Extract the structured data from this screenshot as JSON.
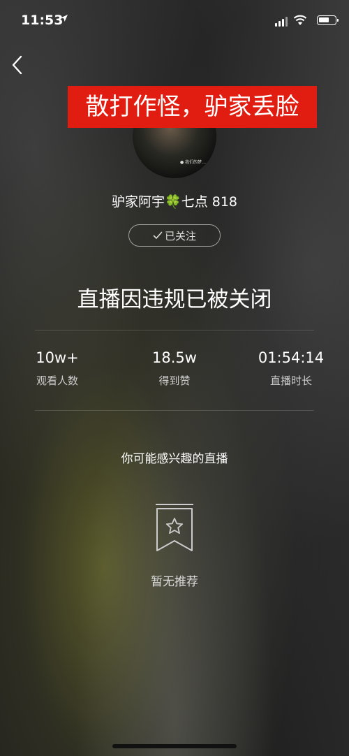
{
  "status": {
    "time": "11:53"
  },
  "banner": {
    "text": "散打作怪，驴家丢脸"
  },
  "avatar": {
    "caption": "● 我们的梦…"
  },
  "streamer": {
    "name": "驴家阿宇",
    "suffix": "七点 818"
  },
  "follow": {
    "label": "已关注"
  },
  "closed_title": "直播因违规已被关闭",
  "stats": [
    {
      "value": "10w+",
      "label": "观看人数"
    },
    {
      "value": "18.5w",
      "label": "得到赞"
    },
    {
      "value": "01:54:14",
      "label": "直播时长"
    }
  ],
  "recommend": {
    "title": "你可能感兴趣的直播",
    "empty_text": "暂无推荐"
  },
  "colors": {
    "banner": "#e01d10",
    "clover": "#3bb54a"
  }
}
